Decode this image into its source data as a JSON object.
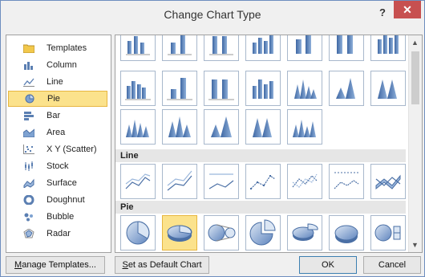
{
  "window": {
    "title": "Change Chart Type",
    "help_label": "?",
    "close_label": "✕"
  },
  "sidebar": {
    "items": [
      {
        "label": "Templates",
        "icon": "folder-icon"
      },
      {
        "label": "Column",
        "icon": "column-chart-icon"
      },
      {
        "label": "Line",
        "icon": "line-chart-icon"
      },
      {
        "label": "Pie",
        "icon": "pie-chart-icon",
        "selected": true
      },
      {
        "label": "Bar",
        "icon": "bar-chart-icon"
      },
      {
        "label": "Area",
        "icon": "area-chart-icon"
      },
      {
        "label": "X Y (Scatter)",
        "icon": "scatter-chart-icon"
      },
      {
        "label": "Stock",
        "icon": "stock-chart-icon"
      },
      {
        "label": "Surface",
        "icon": "surface-chart-icon"
      },
      {
        "label": "Doughnut",
        "icon": "doughnut-chart-icon"
      },
      {
        "label": "Bubble",
        "icon": "bubble-chart-icon"
      },
      {
        "label": "Radar",
        "icon": "radar-chart-icon"
      }
    ]
  },
  "gallery": {
    "sections": [
      {
        "label": "Line"
      },
      {
        "label": "Pie"
      }
    ],
    "selected_pie_index": 1
  },
  "buttons": {
    "manage_templates": {
      "mnemonic": "M",
      "rest": "anage Templates..."
    },
    "set_default": {
      "mnemonic": "S",
      "rest": "et as Default Chart"
    },
    "ok": "OK",
    "cancel": "Cancel"
  },
  "colors": {
    "accent": "#4a7ebb",
    "selected_bg": "#fbe28c",
    "selected_border": "#e7b640",
    "close_red": "#c75050"
  }
}
